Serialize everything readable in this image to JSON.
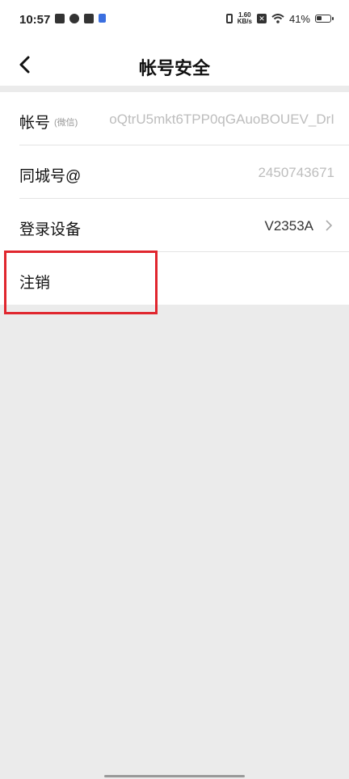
{
  "status_bar": {
    "time": "10:57",
    "net_speed_value": "1.60",
    "net_speed_unit": "KB/s",
    "battery_percent": "41%"
  },
  "header": {
    "title": "帐号安全"
  },
  "rows": [
    {
      "label": "帐号",
      "sub_label": "(微信)",
      "value": "oQtrU5mkt6TPP0qGAuoBOUEV_DrI"
    },
    {
      "label": "同城号@",
      "value": "2450743671"
    },
    {
      "label": "登录设备",
      "value": "V2353A"
    },
    {
      "label": "注销"
    }
  ],
  "colors": {
    "highlight": "#e0262e",
    "background": "#ebebeb"
  }
}
